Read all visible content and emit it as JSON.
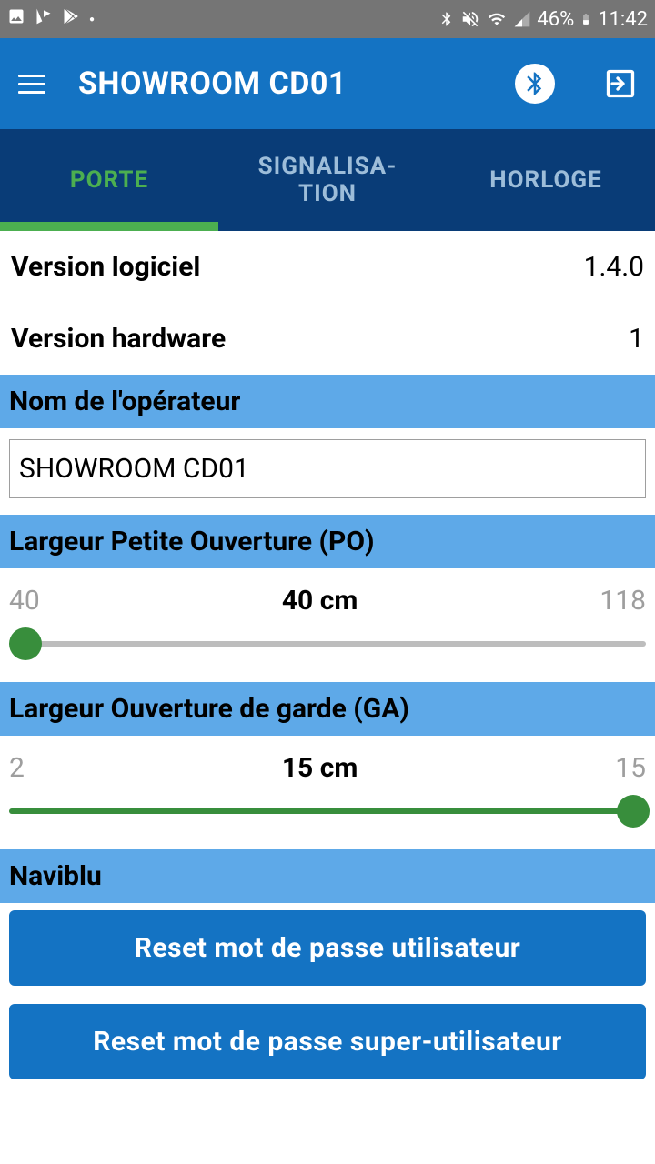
{
  "status": {
    "battery": "46%",
    "time": "11:42"
  },
  "header": {
    "title": "SHOWROOM CD01"
  },
  "tabs": {
    "items": [
      {
        "label": "PORTE",
        "active": true
      },
      {
        "label": "SIGNALISA-\nTION",
        "active": false
      },
      {
        "label": "HORLOGE",
        "active": false
      }
    ]
  },
  "info": {
    "software_label": "Version logiciel",
    "software_value": "1.4.0",
    "hardware_label": "Version hardware",
    "hardware_value": "1"
  },
  "operator": {
    "header": "Nom de l'opérateur",
    "value": "SHOWROOM CD01"
  },
  "po": {
    "header": "Largeur Petite Ouverture (PO)",
    "min": "40",
    "current": "40 cm",
    "max": "118",
    "fill_percent": 0,
    "thumb_percent": 2.5
  },
  "ga": {
    "header": "Largeur Ouverture de garde (GA)",
    "min": "2",
    "current": "15 cm",
    "max": "15",
    "fill_percent": 100,
    "thumb_percent": 98
  },
  "naviblu": {
    "header": "Naviblu",
    "btn_user": "Reset mot de passe utilisateur",
    "btn_super": "Reset mot de passe super-utilisateur"
  }
}
